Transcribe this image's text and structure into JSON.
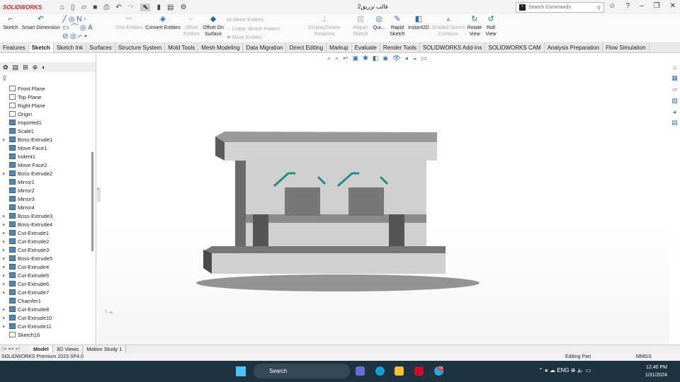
{
  "app": {
    "logo": "SOLIDWORKS",
    "document_title": "قالب تزریق2",
    "search_placeholder": "Search Commands"
  },
  "ribbon": {
    "sketch": "Sketch",
    "smart_dimension": "Smart Dimension",
    "trim_entities": "Trim Entities",
    "convert_entities": "Convert Entities",
    "offset_entities": "Offset Entities",
    "offset_on_surface": "Offset On Surface",
    "mirror_entities": "Mirror Entities",
    "linear_sketch_pattern": "Linear Sketch Pattern",
    "move_entities": "Move Entities",
    "display_delete_relations": "Display/Delete Relations",
    "repair_sketch": "Repair Sketch",
    "quick_snaps": "Qui...",
    "rapid_sketch": "Rapid Sketch",
    "instant2d": "Instant2D",
    "shaded_sketch_contours": "Shaded Sketch Contours",
    "rotate_view": "Rotate View",
    "roll_view": "Roll View"
  },
  "tabs": [
    "Features",
    "Sketch",
    "Sketch Ink",
    "Surfaces",
    "Structure System",
    "Mold Tools",
    "Mesh Modeling",
    "Data Migration",
    "Direct Editing",
    "Markup",
    "Evaluate",
    "Render Tools",
    "SOLIDWORKS Add-Ins",
    "SOLIDWORKS CAM",
    "Analysis Preparation",
    "Flow Simulation"
  ],
  "tree": [
    {
      "label": "Front Plane",
      "type": "plane",
      "exp": false
    },
    {
      "label": "Top Plane",
      "type": "plane",
      "exp": false
    },
    {
      "label": "Right Plane",
      "type": "plane",
      "exp": false
    },
    {
      "label": "Origin",
      "type": "origin",
      "exp": false
    },
    {
      "label": "Imported1",
      "type": "feat",
      "exp": false
    },
    {
      "label": "Scale1",
      "type": "feat",
      "exp": false
    },
    {
      "label": "Boss-Extrude1",
      "type": "feat",
      "exp": true
    },
    {
      "label": "Move Face1",
      "type": "feat",
      "exp": false
    },
    {
      "label": "Indent1",
      "type": "feat",
      "exp": false
    },
    {
      "label": "Move Face2",
      "type": "feat",
      "exp": false
    },
    {
      "label": "Boss-Extrude2",
      "type": "feat",
      "exp": true
    },
    {
      "label": "Mirror1",
      "type": "feat",
      "exp": false
    },
    {
      "label": "Mirror2",
      "type": "feat",
      "exp": false
    },
    {
      "label": "Mirror3",
      "type": "feat",
      "exp": false
    },
    {
      "label": "Mirror4",
      "type": "feat",
      "exp": false
    },
    {
      "label": "Boss-Extrude3",
      "type": "feat",
      "exp": true
    },
    {
      "label": "Boss-Extrude4",
      "type": "feat",
      "exp": true
    },
    {
      "label": "Cut-Extrude1",
      "type": "feat",
      "exp": true
    },
    {
      "label": "Cut-Extrude2",
      "type": "feat",
      "exp": true
    },
    {
      "label": "Cut-Extrude3",
      "type": "feat",
      "exp": true
    },
    {
      "label": "Boss-Extrude5",
      "type": "feat",
      "exp": true
    },
    {
      "label": "Cut-Extrude4",
      "type": "feat",
      "exp": true
    },
    {
      "label": "Cut-Extrude5",
      "type": "feat",
      "exp": true
    },
    {
      "label": "Cut-Extrude6",
      "type": "feat",
      "exp": true
    },
    {
      "label": "Cut-Extrude7",
      "type": "feat",
      "exp": true
    },
    {
      "label": "Chamfer1",
      "type": "feat",
      "exp": false
    },
    {
      "label": "Cut-Extrude8",
      "type": "feat",
      "exp": true
    },
    {
      "label": "Cut-Extrude10",
      "type": "feat",
      "exp": true
    },
    {
      "label": "Cut-Extrude11",
      "type": "feat",
      "exp": true
    },
    {
      "label": "Sketch16",
      "type": "plane",
      "exp": false
    }
  ],
  "bottom_tabs": [
    "Model",
    "3D Views",
    "Motion Study 1"
  ],
  "status": {
    "version": "SOLIDWORKS Premium 2023 SP4.0",
    "mode": "Editing Part",
    "units": "MMGS"
  },
  "taskbar": {
    "search": "Search",
    "lang": "ENG",
    "time": "12:40 PM",
    "date": "1/31/2024",
    "badge": "73"
  }
}
